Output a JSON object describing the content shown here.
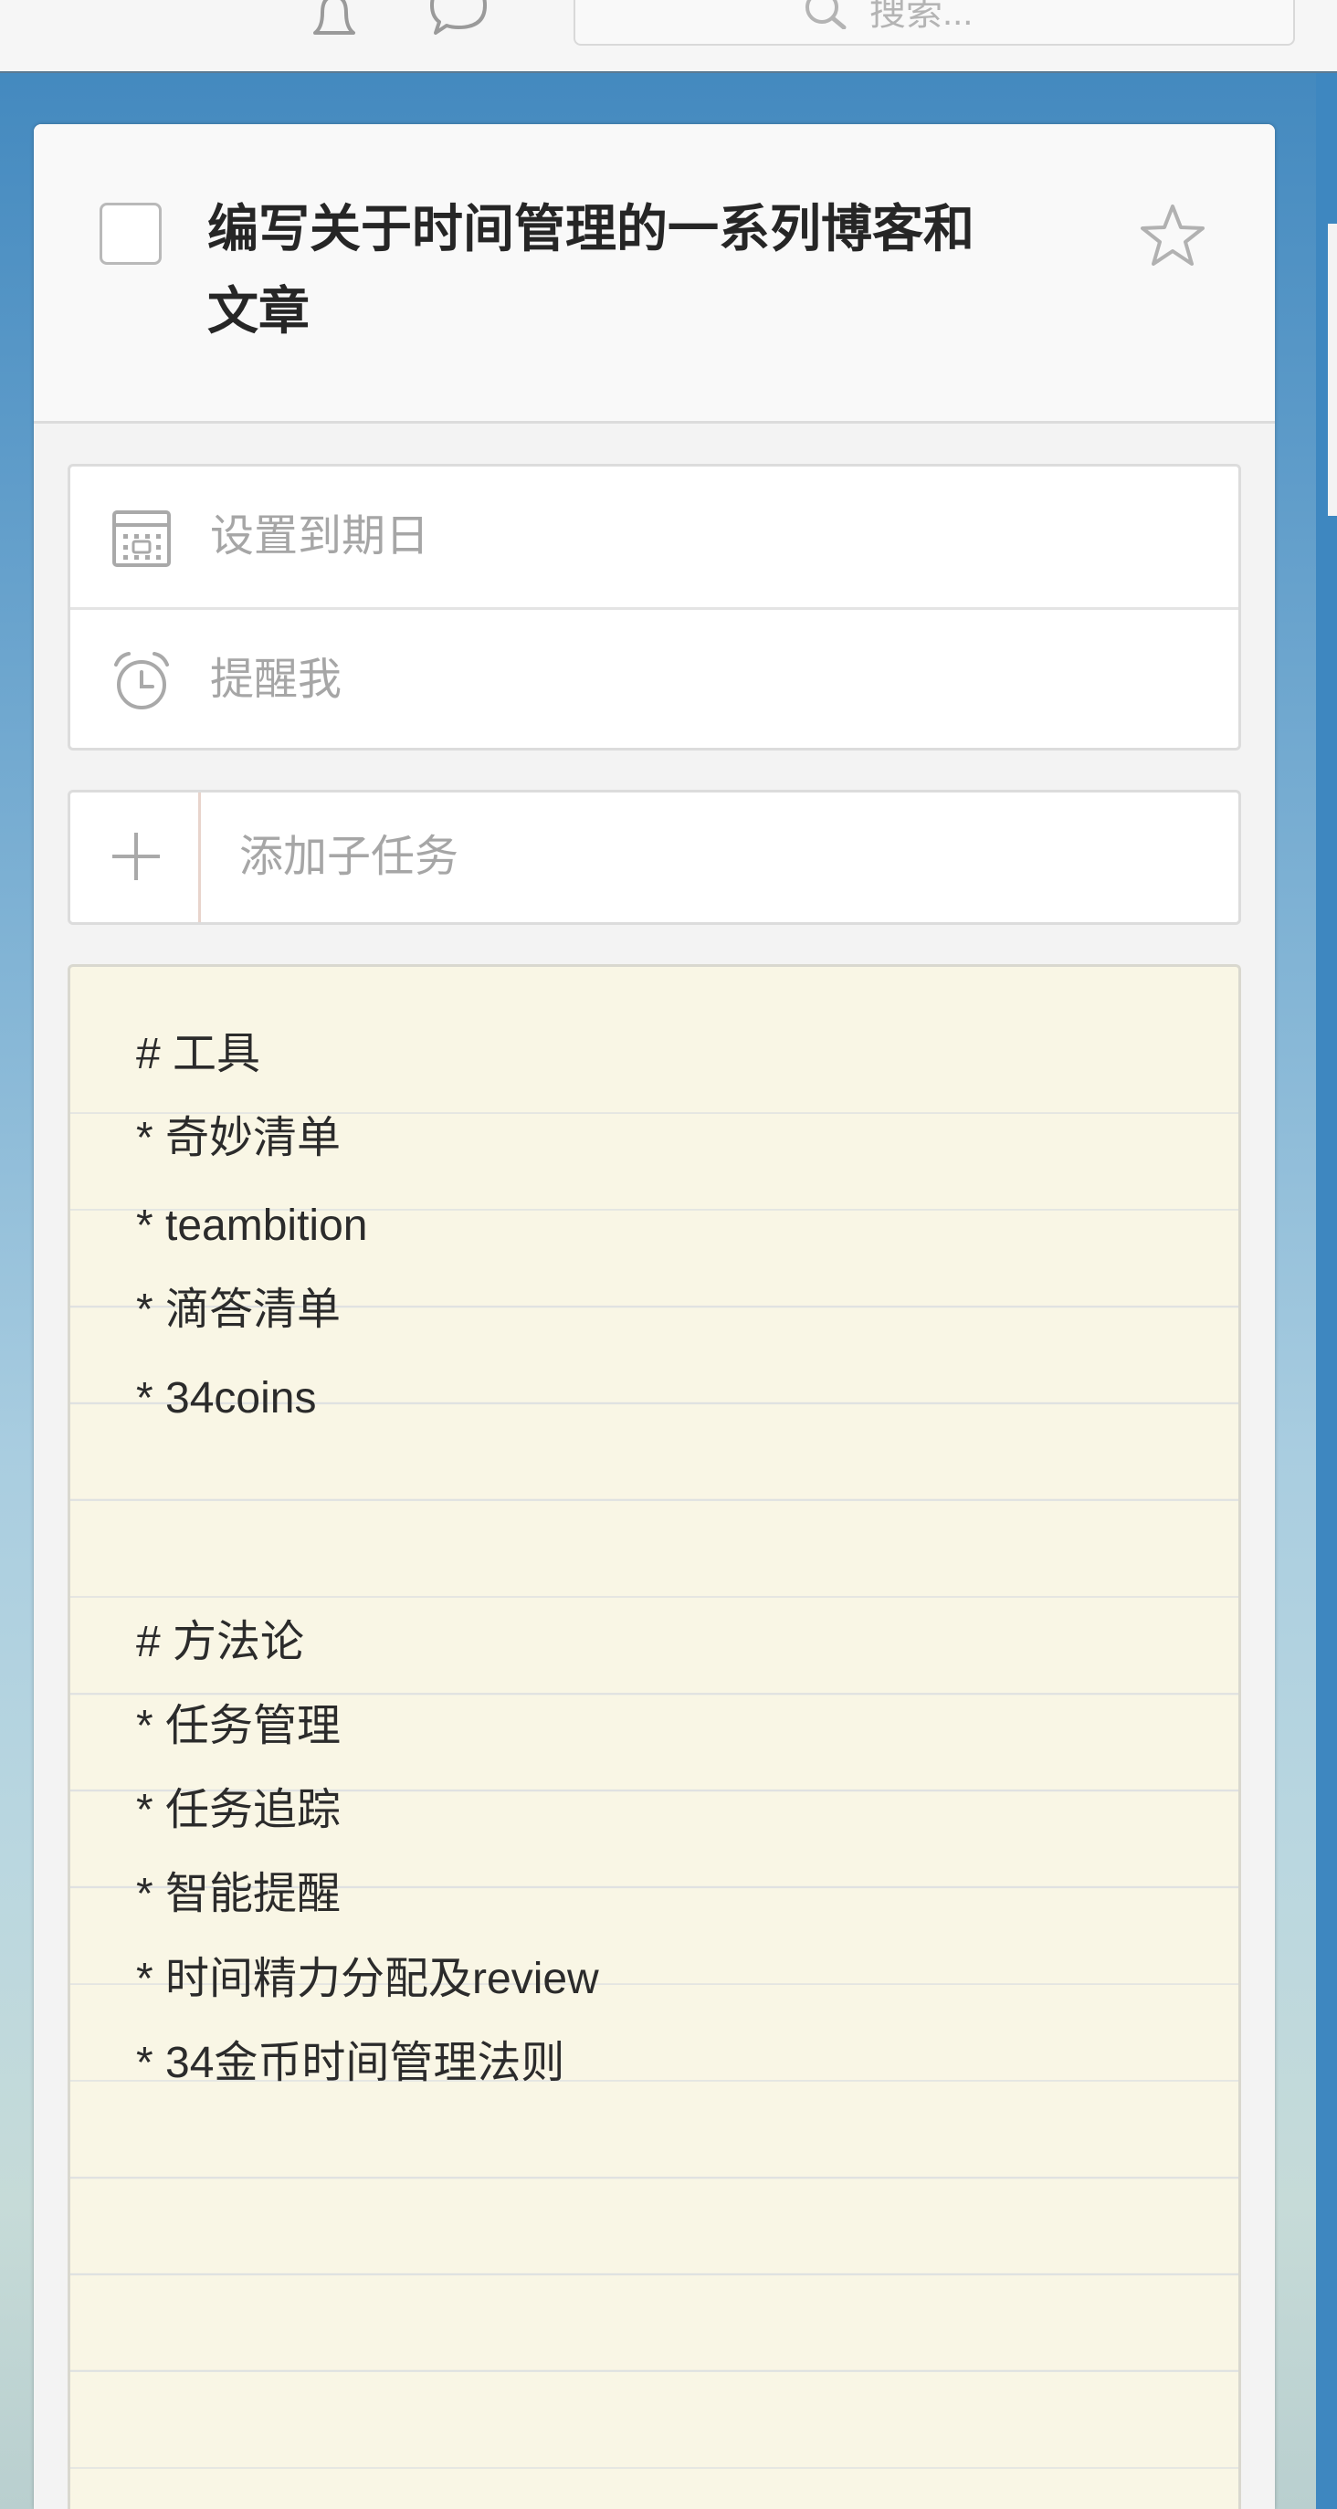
{
  "toolbar": {
    "icons": [
      "bell-icon",
      "chat-bubble-icon",
      "search-icon"
    ],
    "search_placeholder": "搜索..."
  },
  "task": {
    "title_line1": "编写关于时间管理的一系列博客和",
    "title_line2": "文章",
    "completed": false,
    "starred": false
  },
  "dates": {
    "due_date_label": "设置到期日",
    "reminder_label": "提醒我",
    "icons": [
      "calendar-icon",
      "alarm-clock-icon"
    ]
  },
  "subtask": {
    "placeholder": "添加子任务",
    "icon": "plus-icon"
  },
  "notes": {
    "lines": [
      "# 工具",
      "* 奇妙清单",
      "* teambition",
      "* 滴答清单",
      "* 34coins",
      "",
      "",
      "# 方法论",
      "* 任务管理",
      "* 任务追踪",
      "* 智能提醒",
      "* 时间精力分配及review",
      "* 34金币时间管理法则"
    ]
  },
  "colors": {
    "background_blue": "#3f86bd",
    "notes_background": "#f9f6e5",
    "placeholder_gray": "#a6a6a6"
  }
}
